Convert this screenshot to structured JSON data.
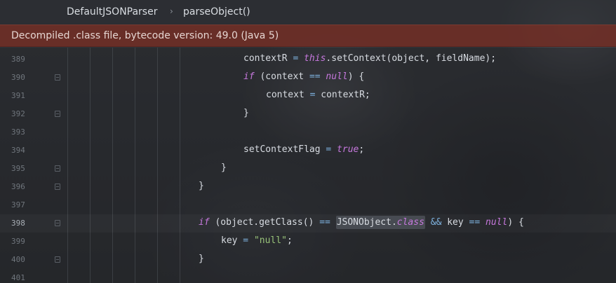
{
  "breadcrumb": {
    "items": [
      "DefaultJSONParser",
      "parseObject()"
    ],
    "separator": "›"
  },
  "banner": {
    "text": "Decompiled .class file, bytecode version: 49.0 (Java 5)"
  },
  "editor": {
    "current_line": "398",
    "lines": [
      {
        "number": "389",
        "code": [
          "contextR",
          " = ",
          "this",
          ".setContext(object, fieldName);"
        ]
      },
      {
        "number": "390",
        "code": [
          "if",
          " (context ",
          "==",
          " ",
          "null",
          ") {"
        ]
      },
      {
        "number": "391",
        "code": [
          "context",
          " = ",
          "contextR;"
        ]
      },
      {
        "number": "392",
        "code": [
          "}"
        ]
      },
      {
        "number": "393",
        "code": []
      },
      {
        "number": "394",
        "code": [
          "setContextFlag",
          " = ",
          "true",
          ";"
        ]
      },
      {
        "number": "395",
        "code": [
          "}"
        ]
      },
      {
        "number": "396",
        "code": [
          "}"
        ]
      },
      {
        "number": "397",
        "code": []
      },
      {
        "number": "398",
        "code": [
          "if",
          " (object.getClass() ",
          "==",
          " ",
          "JSONObject.",
          "class",
          " ",
          "&&",
          " key ",
          "==",
          " ",
          "null",
          ") {"
        ]
      },
      {
        "number": "399",
        "code": [
          "key",
          " = ",
          "\"null\"",
          ";"
        ]
      },
      {
        "number": "400",
        "code": [
          "}"
        ]
      },
      {
        "number": "401",
        "code": []
      }
    ]
  },
  "colors": {
    "banner_bg": "#6c2e26",
    "keyword": "#c678dd",
    "string": "#98c379",
    "operator": "#7fb3e0"
  }
}
